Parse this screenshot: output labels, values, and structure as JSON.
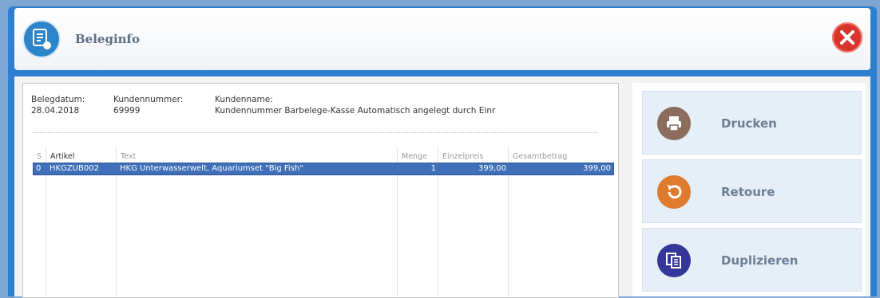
{
  "window": {
    "title": "Beleginfo"
  },
  "header": {
    "belegdatum_label": "Belegdatum:",
    "belegdatum_value": "28.04.2018",
    "kundennummer_label": "Kundennummer:",
    "kundennummer_value": "69999",
    "kundenname_label": "Kundenname:",
    "kundenname_value": "Kundennummer Barbelege-Kasse Automatisch angelegt durch Einr"
  },
  "table": {
    "columns": [
      "S",
      "Artikel",
      "Text",
      "Menge",
      "Einzelpreis",
      "Gesamtbetrag"
    ],
    "rows": [
      {
        "s": "0",
        "artikel": "HKGZUB002",
        "text": "HKG Unterwasserwelt, Aquariumset \"Big Fish\"",
        "menge": "1",
        "einzelpreis": "399,00",
        "gesamtbetrag": "399,00"
      }
    ]
  },
  "actions": {
    "print": {
      "label": "Drucken",
      "color": "#8a6d5c"
    },
    "return": {
      "label": "Retoure",
      "color": "#e07a2e"
    },
    "duplicate": {
      "label": "Duplizieren",
      "color": "#34369a"
    }
  },
  "icons": {
    "app": "receipt-icon",
    "close": "close-icon",
    "print": "printer-icon",
    "return": "undo-icon",
    "duplicate": "copy-document-icon"
  }
}
